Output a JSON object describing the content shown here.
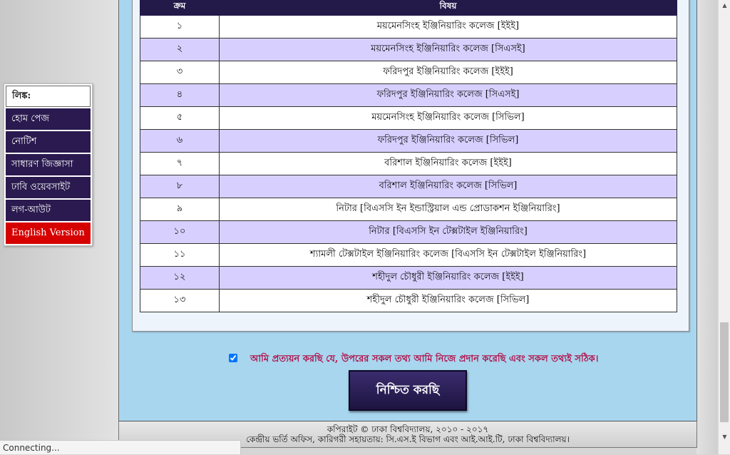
{
  "table": {
    "headers": [
      "ক্রম",
      "বিষয়"
    ],
    "rows": [
      {
        "num": "১",
        "subject": "ময়মেনসিংহ ইঞ্জিনিয়ারিং কলেজ [ইইই]"
      },
      {
        "num": "২",
        "subject": "ময়মেনসিংহ ইঞ্জিনিয়ারিং কলেজ [সিএসই]"
      },
      {
        "num": "৩",
        "subject": "ফরিদপুর ইঞ্জিনিয়ারিং কলেজ [ইইই]"
      },
      {
        "num": "৪",
        "subject": "ফরিদপুর ইঞ্জিনিয়ারিং কলেজ [সিএসই]"
      },
      {
        "num": "৫",
        "subject": "ময়মেনসিংহ ইঞ্জিনিয়ারিং কলেজ [সিভিল]"
      },
      {
        "num": "৬",
        "subject": "ফরিদপুর ইঞ্জিনিয়ারিং কলেজ [সিভিল]"
      },
      {
        "num": "৭",
        "subject": "বরিশাল ইঞ্জিনিয়ারিং কলেজ [ইইই]"
      },
      {
        "num": "৮",
        "subject": "বরিশাল ইঞ্জিনিয়ারিং কলেজ [সিভিল]"
      },
      {
        "num": "৯",
        "subject": "নিটার [বিএসসি ইন ইন্ডাস্ট্রিয়াল এন্ড প্রোডাকশন ইঞ্জিনিয়ারিং]"
      },
      {
        "num": "১০",
        "subject": "নিটার [বিএসসি ইন টেক্সটাইল ইঞ্জিনিয়ারিং]"
      },
      {
        "num": "১১",
        "subject": "শ্যামলী টেক্সটাইল ইঞ্জিনিয়ারিং কলেজ [বিএসসি ইন টেক্সটাইল ইঞ্জিনিয়ারিং]"
      },
      {
        "num": "১২",
        "subject": "শহীদুল চৌধুরী ইঞ্জিনিয়ারিং কলেজ [ইইই]"
      },
      {
        "num": "১৩",
        "subject": "শহীদুল চৌধুরী ইঞ্জিনিয়ারিং কলেজ [সিভিল]"
      }
    ]
  },
  "confirm": {
    "checked": true,
    "text": "আমি প্রত্যয়ন করছি যে, উপরের সকল তথ্য আমি নিজে প্রদান করেছি এবং সকল তথ্যই সঠিক।",
    "button_label": "নিশ্চিত করছি"
  },
  "footer": {
    "line1": "কপিরাইট © ঢাকা বিশ্ববিদ্যালয়, ২০১০ - ২০১৭",
    "line2": "কেন্দ্রীয় ভর্তি অফিস, কারিগরী সহায়তায়: সি.এস.ই বিভাগ এবং আই.আই.টি, ঢাকা বিশ্ববিদ্যালয়।"
  },
  "links": {
    "title": "লিঙ্ক:",
    "items": [
      {
        "label": "হোম পেজ"
      },
      {
        "label": "নোটিশ"
      },
      {
        "label": "সাধারণ জিজ্ঞাসা"
      },
      {
        "label": "ঢাবি ওয়েবসাইট"
      },
      {
        "label": "লগ-আউট"
      },
      {
        "label": "English Version"
      }
    ]
  },
  "status_bar": {
    "text": "Connecting..."
  },
  "colors": {
    "header_bg": "#231a4a",
    "row_even": "#d7d0ff",
    "panel_bg": "#a9d6ef",
    "confirm_text": "#b0124a",
    "english_link": "#d60000"
  }
}
